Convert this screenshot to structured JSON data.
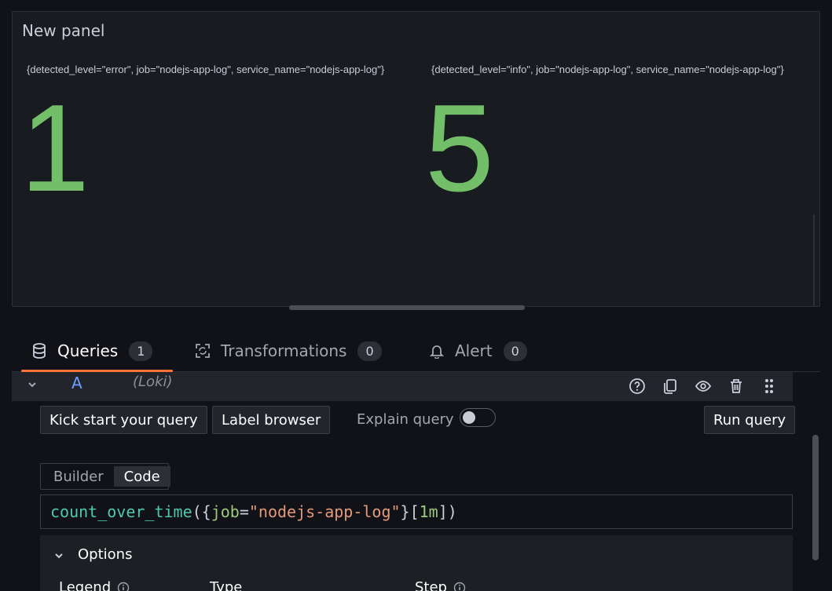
{
  "panel": {
    "title": "New panel",
    "stats": [
      {
        "label": "{detected_level=\"error\", job=\"nodejs-app-log\", service_name=\"nodejs-app-log\"}",
        "value": "1"
      },
      {
        "label": "{detected_level=\"info\", job=\"nodejs-app-log\", service_name=\"nodejs-app-log\"}",
        "value": "5"
      }
    ],
    "value_color": "#73bf69"
  },
  "tabs": [
    {
      "label": "Queries",
      "count": "1",
      "icon": "database-icon"
    },
    {
      "label": "Transformations",
      "count": "0",
      "icon": "transform-icon"
    },
    {
      "label": "Alert",
      "count": "0",
      "icon": "bell-icon"
    }
  ],
  "query": {
    "ref": "A",
    "datasource": "(Loki)",
    "kick_start_label": "Kick start your query",
    "label_browser_label": "Label browser",
    "explain_label": "Explain query",
    "run_label": "Run query",
    "editor_modes": [
      "Builder",
      "Code"
    ],
    "code": {
      "fn": "count_over_time",
      "open": "({",
      "key": "job",
      "eq": "=",
      "str": "\"nodejs-app-log\"",
      "close": "}[",
      "range": "1m",
      "end": "])"
    },
    "options": {
      "title": "Options",
      "fields": [
        "Legend",
        "Type",
        "Step"
      ]
    }
  },
  "colors": {
    "accent": "#ff7238",
    "query_letter": "#6e9fff"
  }
}
